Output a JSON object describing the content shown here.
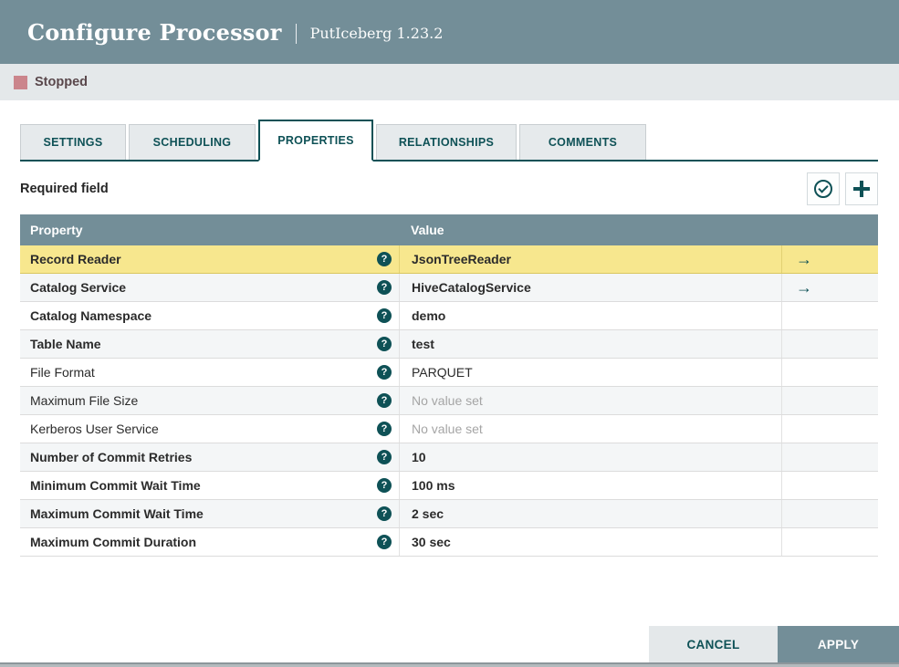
{
  "header": {
    "title": "Configure Processor",
    "subtitle": "PutIceberg 1.23.2"
  },
  "status": {
    "label": "Stopped"
  },
  "tabs": [
    {
      "label": "SETTINGS",
      "active": false
    },
    {
      "label": "SCHEDULING",
      "active": false
    },
    {
      "label": "PROPERTIES",
      "active": true
    },
    {
      "label": "RELATIONSHIPS",
      "active": false
    },
    {
      "label": "COMMENTS",
      "active": false
    }
  ],
  "toolbar": {
    "required_field_label": "Required field"
  },
  "table": {
    "columns": {
      "property": "Property",
      "value": "Value"
    },
    "rows": [
      {
        "property": "Record Reader",
        "value": "JsonTreeReader",
        "required": true,
        "highlighted": true,
        "has_goto": true,
        "placeholder": false
      },
      {
        "property": "Catalog Service",
        "value": "HiveCatalogService",
        "required": true,
        "highlighted": false,
        "has_goto": true,
        "placeholder": false
      },
      {
        "property": "Catalog Namespace",
        "value": "demo",
        "required": true,
        "highlighted": false,
        "has_goto": false,
        "placeholder": false
      },
      {
        "property": "Table Name",
        "value": "test",
        "required": true,
        "highlighted": false,
        "has_goto": false,
        "placeholder": false
      },
      {
        "property": "File Format",
        "value": "PARQUET",
        "required": false,
        "highlighted": false,
        "has_goto": false,
        "placeholder": false
      },
      {
        "property": "Maximum File Size",
        "value": "No value set",
        "required": false,
        "highlighted": false,
        "has_goto": false,
        "placeholder": true
      },
      {
        "property": "Kerberos User Service",
        "value": "No value set",
        "required": false,
        "highlighted": false,
        "has_goto": false,
        "placeholder": true
      },
      {
        "property": "Number of Commit Retries",
        "value": "10",
        "required": true,
        "highlighted": false,
        "has_goto": false,
        "placeholder": false
      },
      {
        "property": "Minimum Commit Wait Time",
        "value": "100 ms",
        "required": true,
        "highlighted": false,
        "has_goto": false,
        "placeholder": false
      },
      {
        "property": "Maximum Commit Wait Time",
        "value": "2 sec",
        "required": true,
        "highlighted": false,
        "has_goto": false,
        "placeholder": false
      },
      {
        "property": "Maximum Commit Duration",
        "value": "30 sec",
        "required": true,
        "highlighted": false,
        "has_goto": false,
        "placeholder": false
      }
    ]
  },
  "footer": {
    "cancel_label": "CANCEL",
    "apply_label": "APPLY"
  },
  "icons": {
    "verify": "check-circle-icon",
    "add": "plus-icon",
    "help": "question-circle-icon",
    "goto": "arrow-right-icon",
    "stopped": "stop-square-icon"
  },
  "colors": {
    "header_slate": "#738E98",
    "accent_teal": "#0e5156",
    "highlight_yellow": "#F7E78E",
    "stopped_red": "#CB858C",
    "status_bar_bg": "#E4E8EA"
  }
}
